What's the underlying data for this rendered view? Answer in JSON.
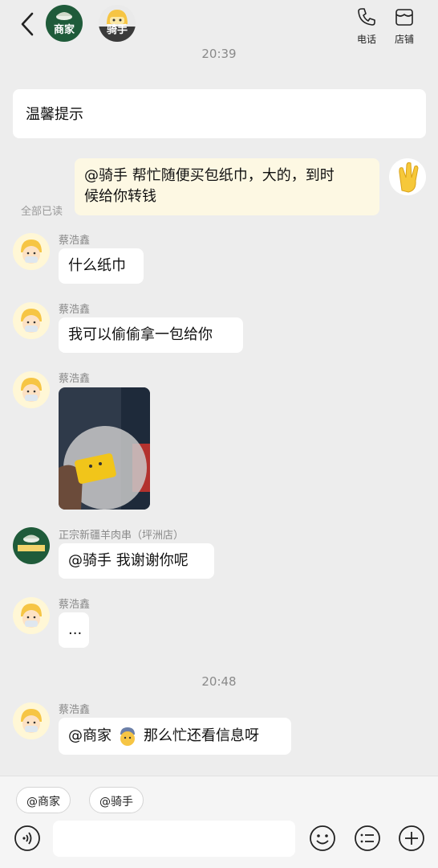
{
  "header": {
    "merchant_label": "商家",
    "rider_label": "骑手",
    "phone_label": "电话",
    "store_label": "店铺"
  },
  "times": [
    "20:39",
    "20:48"
  ],
  "notice": "温馨提示",
  "read_status": "全部已读",
  "messages": [
    {
      "sender": "",
      "text": "@骑手 帮忙随便买包纸巾，大的，到时候给你转钱",
      "line1": "@骑手 帮忙随便买包纸巾，大的，到时",
      "line2": "候给你转钱"
    },
    {
      "sender": "蔡浩鑫",
      "text": "什么纸巾"
    },
    {
      "sender": "蔡浩鑫",
      "text": "我可以偷偷拿一包给你"
    },
    {
      "sender": "蔡浩鑫",
      "text": ""
    },
    {
      "sender": "正宗新疆羊肉串（坪洲店）",
      "text": "@骑手 我谢谢你呢"
    },
    {
      "sender": "蔡浩鑫",
      "text": "..."
    },
    {
      "sender": "蔡浩鑫",
      "text_a": "@商家",
      "text_b": "那么忙还看信息呀"
    }
  ],
  "quick_mentions": [
    "@商家",
    "@骑手"
  ],
  "colors": {
    "background": "#ededed",
    "my_bubble": "#fdf8e3",
    "merchant_green": "#1f5b3a",
    "rider_yellow": "#f6c544"
  }
}
